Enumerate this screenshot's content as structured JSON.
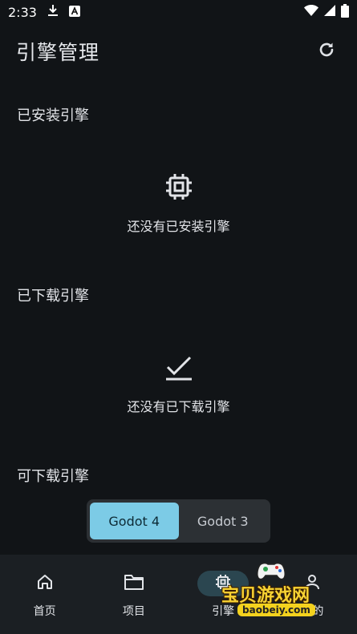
{
  "status_bar": {
    "time": "2:33",
    "icons": [
      "download-icon",
      "app-a-icon",
      "wifi-icon",
      "signal-icon",
      "battery-icon"
    ]
  },
  "header": {
    "title": "引擎管理",
    "refresh_icon": "refresh-icon"
  },
  "sections": {
    "installed": {
      "title": "已安装引擎",
      "empty_icon": "chip-icon",
      "empty_text": "还没有已安装引擎"
    },
    "downloaded": {
      "title": "已下载引擎",
      "empty_icon": "check-icon",
      "empty_text": "还没有已下载引擎"
    },
    "available": {
      "title": "可下载引擎"
    }
  },
  "version_toggle": {
    "options": [
      "Godot 4",
      "Godot 3"
    ],
    "selected": "Godot 4"
  },
  "bottom_nav": {
    "items": [
      {
        "label": "首页",
        "icon": "home-icon"
      },
      {
        "label": "项目",
        "icon": "folder-icon"
      },
      {
        "label": "引擎",
        "icon": "chip-icon",
        "active": true
      },
      {
        "label": "我的",
        "icon": "person-icon"
      }
    ]
  },
  "watermark": {
    "text": "宝贝游戏网",
    "url": "baobeiy.com"
  },
  "colors": {
    "background": "#111417",
    "accent": "#7ccbe6",
    "nav_background": "#1b1f23",
    "watermark_yellow": "#f7d233"
  }
}
